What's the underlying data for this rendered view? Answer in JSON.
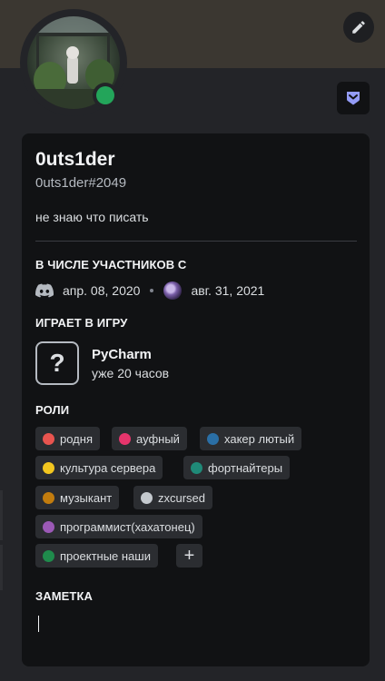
{
  "profile": {
    "display_name": "0uts1der",
    "tag": "0uts1der#2049",
    "about": "не знаю что писать",
    "status": "online",
    "status_color": "#23a55a",
    "accent_color": "#949cf7"
  },
  "member_since": {
    "title": "В ЧИСЛЕ УЧАСТНИКОВ С",
    "discord_date": "апр. 08, 2020",
    "server_date": "авг. 31, 2021"
  },
  "activity": {
    "title": "ИГРАЕТ В ИГРУ",
    "game_icon": "question-mark-icon",
    "game_icon_glyph": "?",
    "game": "PyCharm",
    "elapsed": "уже 20 часов"
  },
  "roles": {
    "title": "РОЛИ",
    "items": [
      {
        "name": "родня",
        "color": "#e8544f"
      },
      {
        "name": "ауфный",
        "color": "#e6356c"
      },
      {
        "name": "хакер лютый",
        "color": "#2a6fa6"
      },
      {
        "name": "культура сервера",
        "color": "#f2c61f"
      },
      {
        "name": "фортнайтеры",
        "color": "#1f8a78"
      },
      {
        "name": "музыкант",
        "color": "#c27c0e"
      },
      {
        "name": "zxcursed",
        "color": "#c4c9ce"
      },
      {
        "name": "программист(хахатонец)",
        "color": "#9b59b6"
      },
      {
        "name": "проектные наши",
        "color": "#1f8b4c"
      }
    ],
    "add_label": "+"
  },
  "note": {
    "title": "ЗАМЕТКА",
    "value": ""
  }
}
